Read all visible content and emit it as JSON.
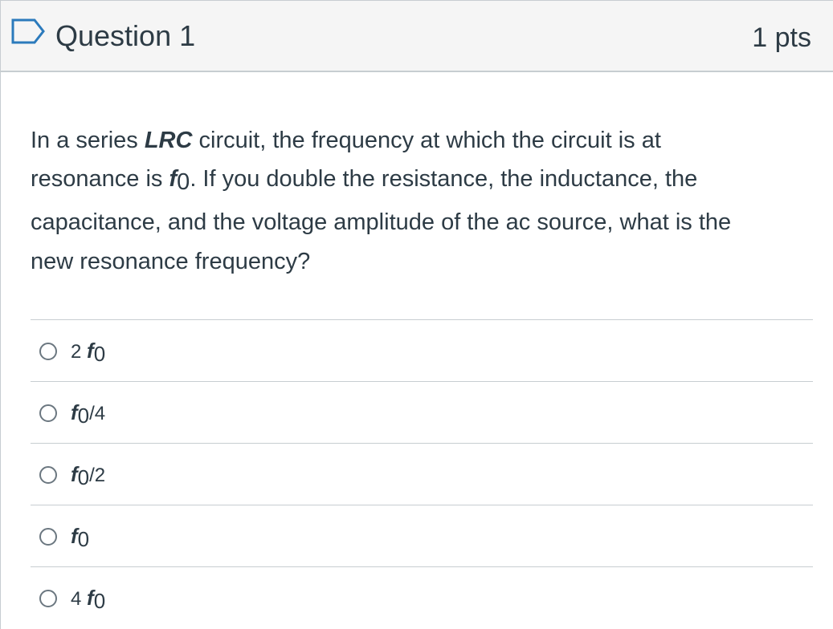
{
  "header": {
    "title": "Question 1",
    "points": "1 pts"
  },
  "question": {
    "line1_pre": "In a series ",
    "line1_bold": "LRC",
    "line1_post": " circuit, the frequency at which the circuit is at",
    "line2_pre": "resonance is ",
    "symbol_f": "f",
    "symbol_zero": "0",
    "line2_post": ". If you double the resistance, the inductance, the",
    "line3": "capacitance, and the voltage amplitude of the ac source, what is the",
    "line4": "new resonance frequency?"
  },
  "answers": [
    {
      "prefix": "2 ",
      "f": "f",
      "zero": "0",
      "suffix": ""
    },
    {
      "prefix": "",
      "f": "f",
      "zero": "0",
      "suffix": "/4"
    },
    {
      "prefix": "",
      "f": "f",
      "zero": "0",
      "suffix": "/2"
    },
    {
      "prefix": "",
      "f": "f",
      "zero": "0",
      "suffix": ""
    },
    {
      "prefix": "4 ",
      "f": "f",
      "zero": "0",
      "suffix": ""
    }
  ],
  "colors": {
    "text": "#2d3b45",
    "header_bg": "#f5f5f5",
    "divider": "#c7cdd1",
    "flag": "#2b7abc"
  },
  "icons": {
    "flag": "flag-outline-icon",
    "radio": "radio-unchecked"
  }
}
